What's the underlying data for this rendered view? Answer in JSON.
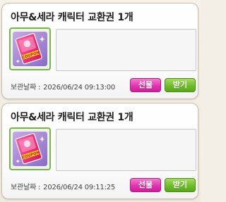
{
  "items": [
    {
      "title": "아무&세라 캐릭터 교환권 1개",
      "icon": "coupon-ticket-icon",
      "description": "",
      "date_label": "보관날짜 :",
      "date_value": "2026/06/24 09:13:00",
      "gift_label": "선물",
      "receive_label": "받기"
    },
    {
      "title": "아무&세라 캐릭터 교환권 1개",
      "icon": "coupon-ticket-icon",
      "description": "",
      "date_label": "보관날짜 :",
      "date_value": "2026/06/24 09:11:25",
      "gift_label": "선물",
      "receive_label": "받기"
    }
  ],
  "colors": {
    "gift_button": "#e234ae",
    "receive_button": "#6fbd2b",
    "thumb_border": "#78b548"
  }
}
